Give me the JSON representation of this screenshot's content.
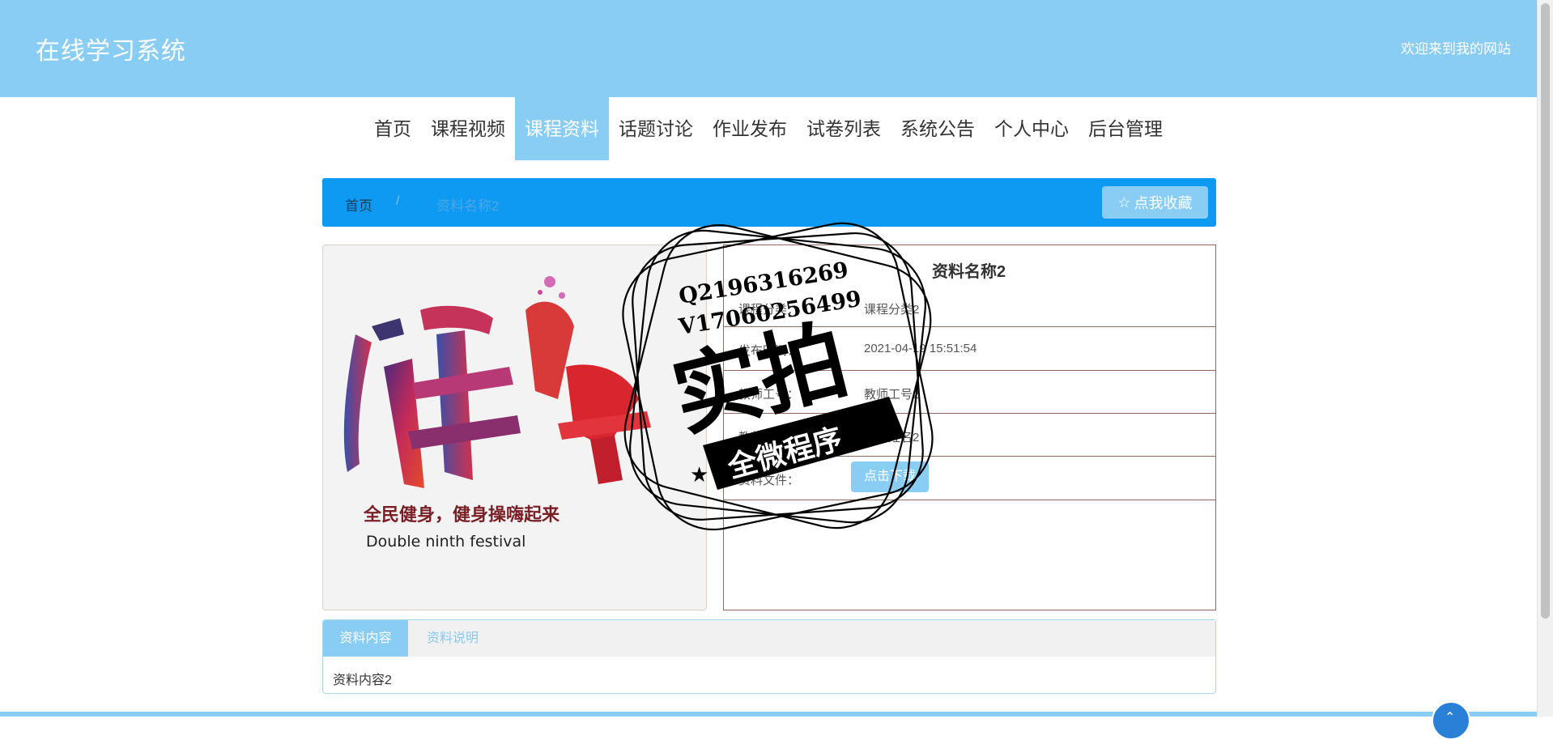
{
  "header": {
    "site_title": "在线学习系统",
    "welcome_text": "欢迎来到我的网站"
  },
  "nav": {
    "items": [
      {
        "label": "首页"
      },
      {
        "label": "课程视频"
      },
      {
        "label": "课程资料",
        "active": true
      },
      {
        "label": "话题讨论"
      },
      {
        "label": "作业发布"
      },
      {
        "label": "试卷列表"
      },
      {
        "label": "系统公告"
      },
      {
        "label": "个人中心"
      },
      {
        "label": "后台管理"
      }
    ]
  },
  "breadcrumb": {
    "home": "首页",
    "separator": "/",
    "current": "资料名称2",
    "favorite_icon": "star-icon",
    "favorite_label": "点我收藏"
  },
  "poster": {
    "headline": "全民健身，健身操嗨起来",
    "subline": "Double ninth festival",
    "art_text": "健身操"
  },
  "detail": {
    "title": "资料名称2",
    "rows": [
      {
        "label": "课程分类：",
        "value": "课程分类2"
      },
      {
        "label": "发布时间：",
        "value": "2021-04-19 15:51:54"
      },
      {
        "label": "教师工号：",
        "value": "教师工号2"
      },
      {
        "label": "教师姓名：",
        "value": "教师姓名2"
      },
      {
        "label": "资料文件：",
        "value": "点击下载"
      }
    ]
  },
  "tabs": {
    "items": [
      {
        "label": "资料内容",
        "active": true
      },
      {
        "label": "资料说明"
      }
    ],
    "content": "资料内容2"
  },
  "watermark": {
    "line1": "Q2196316269",
    "line2": "V17060256499",
    "main": "实拍",
    "ribbon": "全微程序"
  },
  "colors": {
    "header_bg": "#89cdf5",
    "breadcrumb_bg": "#0e9af2",
    "accent": "#89cdf5",
    "table_border": "#8c6b5b"
  }
}
